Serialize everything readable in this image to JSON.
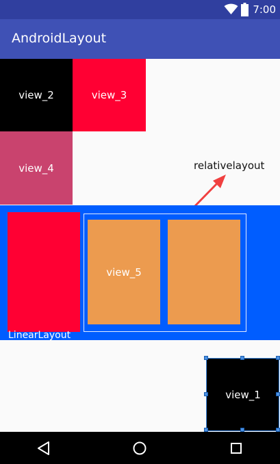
{
  "status_bar": {
    "time": "7:00",
    "icons": [
      "wifi-icon",
      "battery-icon"
    ],
    "color": "#303f9f"
  },
  "app_bar": {
    "title": "AndroidLayout",
    "color": "#3f51b5"
  },
  "views": {
    "view_1": "view_1",
    "view_2": "view_2",
    "view_3": "view_3",
    "view_4": "view_4",
    "view_5": "view_5"
  },
  "annotations": {
    "relative_layout": "relativelayout",
    "linear_layout": "LinearLayout"
  },
  "colors": {
    "black": "#000000",
    "red": "#ff0033",
    "pink": "#c9436e",
    "blue": "#005dff",
    "orange": "#ec9b4f",
    "arrow": "#f04040"
  },
  "nav_bar": {
    "buttons": [
      "back-icon",
      "home-icon",
      "recents-icon"
    ]
  }
}
